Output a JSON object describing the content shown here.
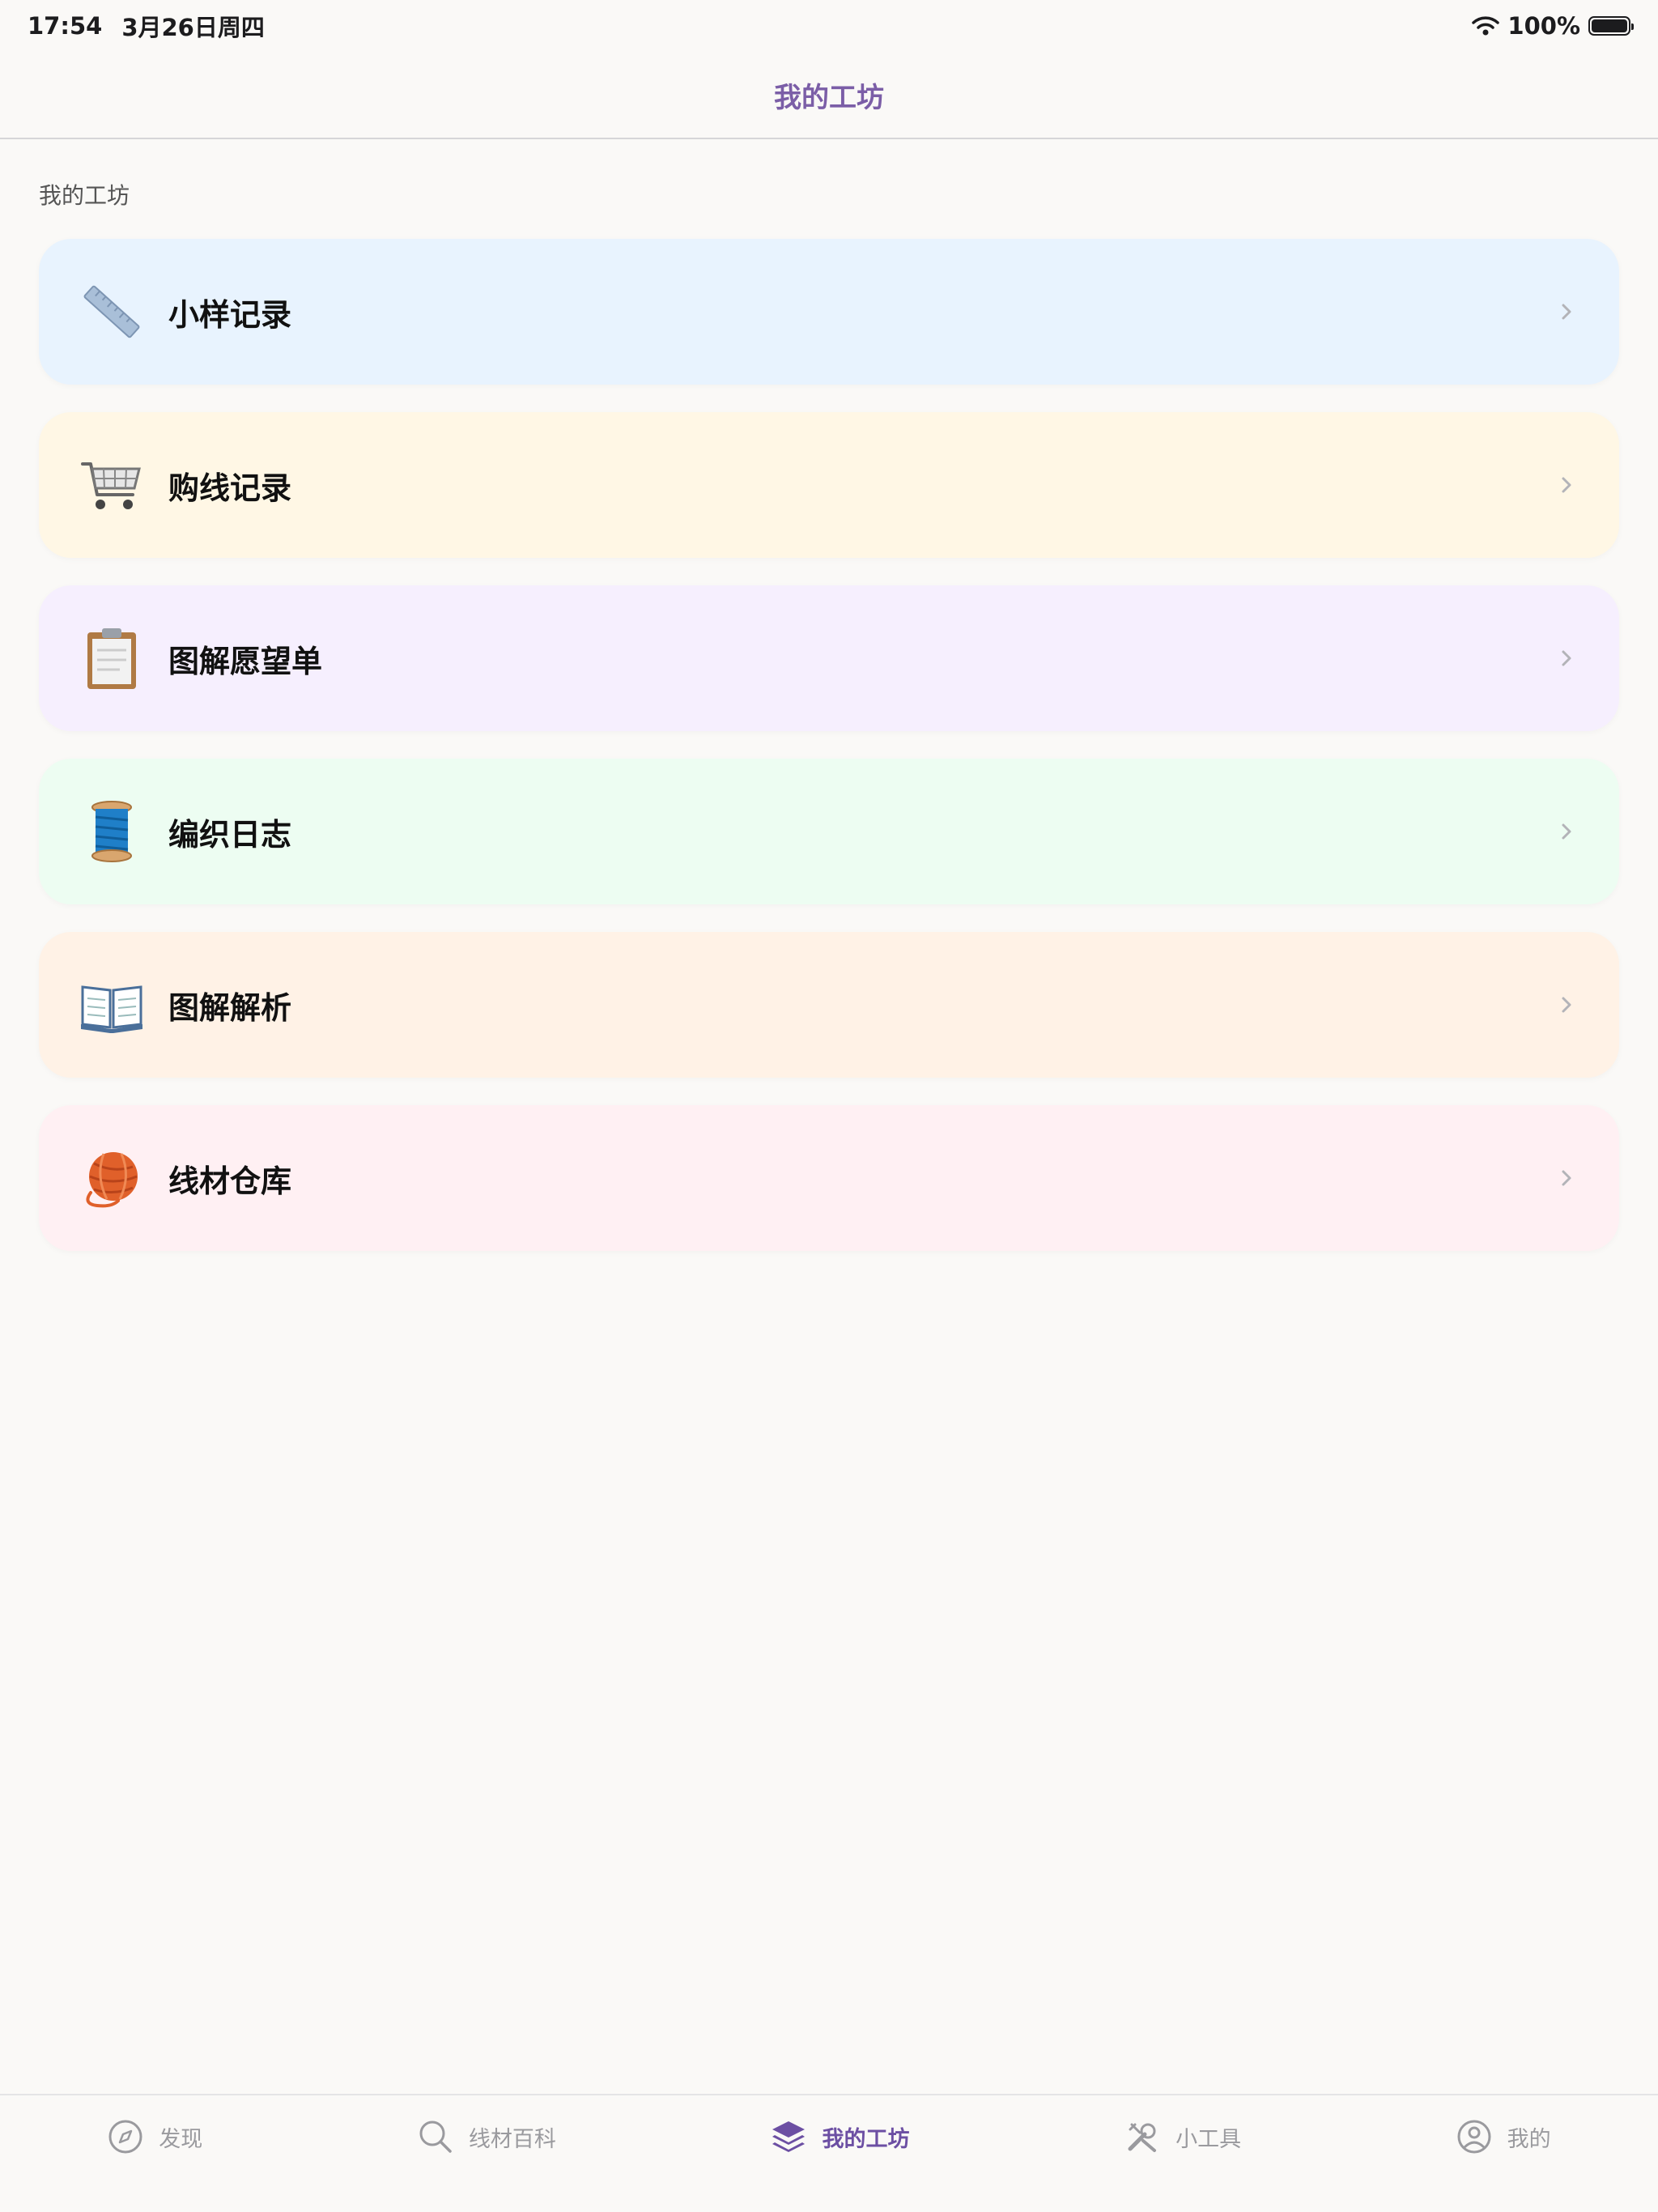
{
  "status": {
    "time": "17:54",
    "date": "3月26日周四",
    "battery": "100%"
  },
  "nav": {
    "title": "我的工坊"
  },
  "section": {
    "label": "我的工坊"
  },
  "items": [
    {
      "label": "小样记录",
      "bg": "#e8f3fe",
      "icon": "ruler-icon"
    },
    {
      "label": "购线记录",
      "bg": "#fff7e5",
      "icon": "shopping-cart-icon"
    },
    {
      "label": "图解愿望单",
      "bg": "#f6effe",
      "icon": "clipboard-icon"
    },
    {
      "label": "编织日志",
      "bg": "#edfdf2",
      "icon": "thread-spool-icon"
    },
    {
      "label": "图解解析",
      "bg": "#fff2e6",
      "icon": "open-book-icon"
    },
    {
      "label": "线材仓库",
      "bg": "#fff0f3",
      "icon": "yarn-ball-icon"
    }
  ],
  "tabs": [
    {
      "label": "发现",
      "icon": "compass-icon",
      "active": false
    },
    {
      "label": "线材百科",
      "icon": "search-icon",
      "active": false
    },
    {
      "label": "我的工坊",
      "icon": "layers-icon",
      "active": true
    },
    {
      "label": "小工具",
      "icon": "tools-icon",
      "active": false
    },
    {
      "label": "我的",
      "icon": "profile-icon",
      "active": false
    }
  ],
  "colors": {
    "accent": "#7b5ea7",
    "tab_active": "#6c4fa3",
    "tab_inactive": "#9a9a9e"
  }
}
